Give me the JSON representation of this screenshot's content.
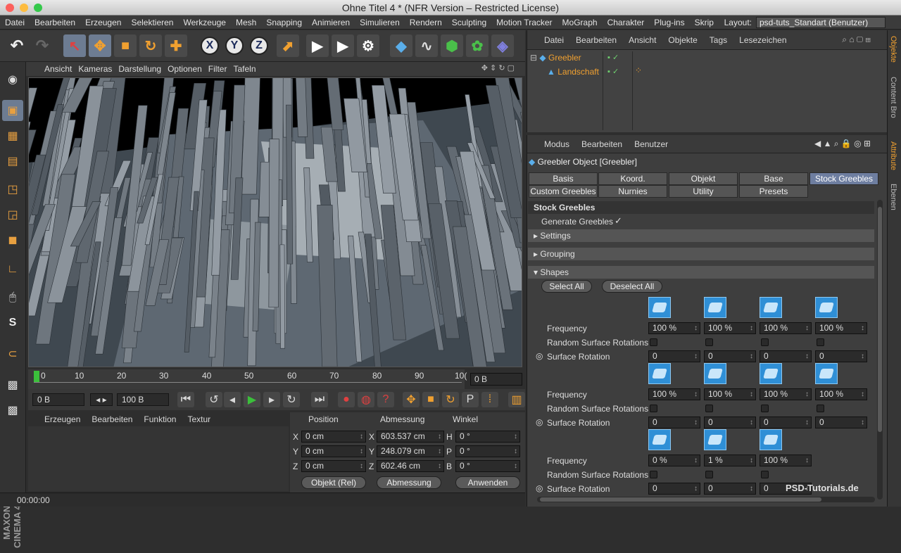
{
  "window": {
    "title": "Ohne Titel 4 * (NFR Version – Restricted License)"
  },
  "menubar": {
    "items": [
      "Datei",
      "Bearbeiten",
      "Erzeugen",
      "Selektieren",
      "Werkzeuge",
      "Mesh",
      "Snapping",
      "Animieren",
      "Simulieren",
      "Rendern",
      "Sculpting",
      "Motion Tracker",
      "MoGraph",
      "Charakter",
      "Plug-ins",
      "Skrip"
    ],
    "layout_label": "Layout:",
    "layout_value": "psd-tuts_Standart (Benutzer)"
  },
  "viewport": {
    "menu": [
      "Ansicht",
      "Kameras",
      "Darstellung",
      "Optionen",
      "Filter",
      "Tafeln"
    ]
  },
  "timeline": {
    "ticks": [
      "0",
      "10",
      "20",
      "30",
      "40",
      "50",
      "60",
      "70",
      "80",
      "90",
      "10("
    ],
    "frame": "0 B"
  },
  "playbar": {
    "start": "0 B",
    "end": "100 B"
  },
  "material": {
    "menu": [
      "Erzeugen",
      "Bearbeiten",
      "Funktion",
      "Textur"
    ]
  },
  "coords": {
    "headers": [
      "Position",
      "Abmessung",
      "Winkel"
    ],
    "rows": [
      {
        "a": "X",
        "pos": "0 cm",
        "b": "X",
        "size": "603.537 cm",
        "c": "H",
        "angle": "0 °"
      },
      {
        "a": "Y",
        "pos": "0 cm",
        "b": "Y",
        "size": "248.079 cm",
        "c": "P",
        "angle": "0 °"
      },
      {
        "a": "Z",
        "pos": "0 cm",
        "b": "Z",
        "size": "602.46 cm",
        "c": "B",
        "angle": "0 °"
      }
    ],
    "mode": "Objekt (Rel)",
    "size_mode": "Abmessung",
    "apply": "Anwenden"
  },
  "status": {
    "time": "00:00:00"
  },
  "objects": {
    "menu": [
      "Datei",
      "Bearbeiten",
      "Ansicht",
      "Objekte",
      "Tags",
      "Lesezeichen"
    ],
    "items": [
      {
        "name": "Greebler"
      },
      {
        "name": "Landschaft"
      }
    ]
  },
  "attributes": {
    "menu": [
      "Modus",
      "Bearbeiten",
      "Benutzer"
    ],
    "object_title": "Greebler Object [Greebler]",
    "tabs_row1": [
      "Basis",
      "Koord.",
      "Objekt",
      "Base",
      "Stock Greebles"
    ],
    "tabs_row2": [
      "Custom Greebles",
      "Nurnies",
      "Utility",
      "Presets"
    ],
    "section_title": "Stock Greebles",
    "generate_label": "Generate Greebles",
    "groups": [
      "Settings",
      "Grouping",
      "Shapes"
    ],
    "select_all": "Select All",
    "deselect_all": "Deselect All",
    "freq_label": "Frequency",
    "random_label": "Random Surface Rotations",
    "rotation_label": "Surface Rotation",
    "shape_rows": [
      {
        "freq": [
          "100 %",
          "100 %",
          "100 %",
          "100 %"
        ],
        "rot": [
          "0",
          "0",
          "0",
          "0"
        ]
      },
      {
        "freq": [
          "100 %",
          "100 %",
          "100 %",
          "100 %"
        ],
        "rot": [
          "0",
          "0",
          "0",
          "0"
        ]
      },
      {
        "freq": [
          "0 %",
          "1 %",
          "100 %"
        ],
        "rot": [
          "0",
          "0",
          "0"
        ]
      }
    ]
  },
  "side_tabs": [
    "Objekte",
    "Content Bro",
    "Attribute",
    "Ebenen"
  ],
  "branding": {
    "logo": "MAXON CINEMA 4D",
    "watermark": "PSD-Tutorials.de"
  }
}
